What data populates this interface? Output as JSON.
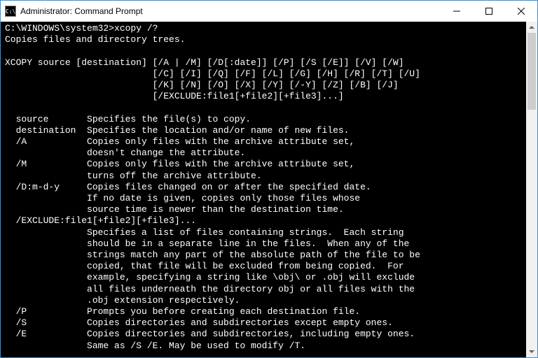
{
  "window": {
    "title": "Administrator: Command Prompt",
    "icon_label": "C:\\"
  },
  "terminal": {
    "prompt_line": "C:\\WINDOWS\\system32>xcopy /?",
    "description": "Copies files and directory trees.",
    "syntax_line1": "XCOPY source [destination] [/A | /M] [/D[:date]] [/P] [/S [/E]] [/V] [/W]",
    "syntax_line2": "                           [/C] [/I] [/Q] [/F] [/L] [/G] [/H] [/R] [/T] [/U]",
    "syntax_line3": "                           [/K] [/N] [/O] [/X] [/Y] [/-Y] [/Z] [/B] [/J]",
    "syntax_line4": "                           [/EXCLUDE:file1[+file2][+file3]...]",
    "params": {
      "source": "  source       Specifies the file(s) to copy.",
      "destination": "  destination  Specifies the location and/or name of new files.",
      "a1": "  /A           Copies only files with the archive attribute set,",
      "a2": "               doesn't change the attribute.",
      "m1": "  /M           Copies only files with the archive attribute set,",
      "m2": "               turns off the archive attribute.",
      "d1": "  /D:m-d-y     Copies files changed on or after the specified date.",
      "d2": "               If no date is given, copies only those files whose",
      "d3": "               source time is newer than the destination time.",
      "ex1": "  /EXCLUDE:file1[+file2][+file3]...",
      "ex2": "               Specifies a list of files containing strings.  Each string",
      "ex3": "               should be in a separate line in the files.  When any of the",
      "ex4": "               strings match any part of the absolute path of the file to be",
      "ex5": "               copied, that file will be excluded from being copied.  For",
      "ex6": "               example, specifying a string like \\obj\\ or .obj will exclude",
      "ex7": "               all files underneath the directory obj or all files with the",
      "ex8": "               .obj extension respectively.",
      "p": "  /P           Prompts you before creating each destination file.",
      "s": "  /S           Copies directories and subdirectories except empty ones.",
      "e1": "  /E           Copies directories and subdirectories, including empty ones.",
      "e2": "               Same as /S /E. May be used to modify /T."
    }
  }
}
